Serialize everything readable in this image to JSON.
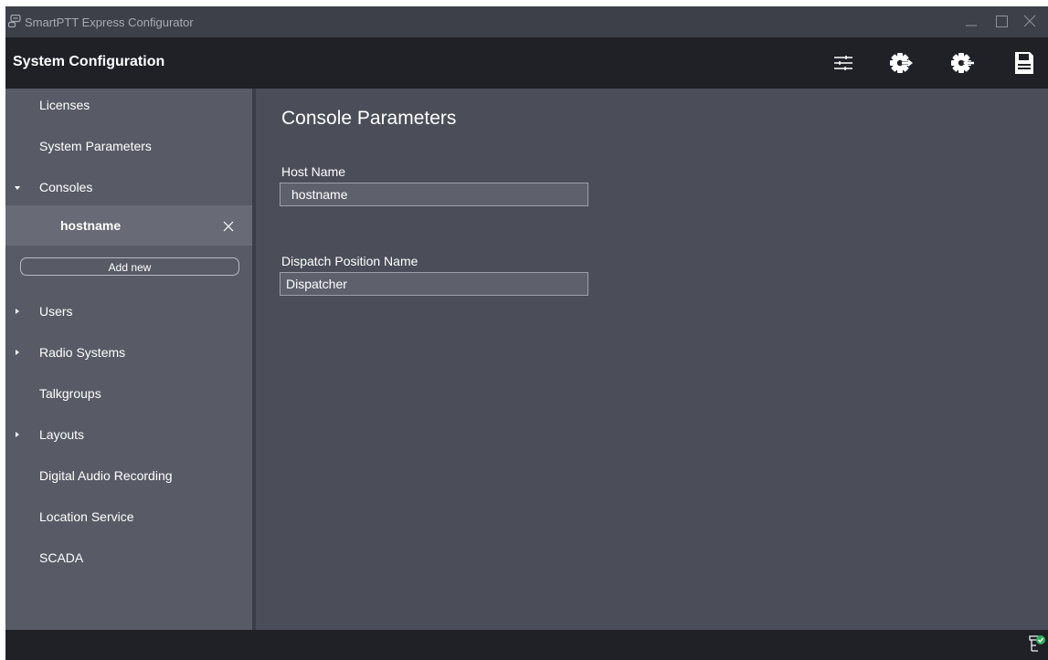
{
  "window": {
    "app_title": "SmartPTT Express Configurator"
  },
  "header": {
    "title": "System Configuration",
    "icons": [
      "filters-icon",
      "export-gear-icon",
      "import-gear-icon",
      "save-icon"
    ]
  },
  "sidebar": {
    "items": {
      "licenses": "Licenses",
      "system_parameters": "System Parameters",
      "consoles": "Consoles",
      "users": "Users",
      "radio_systems": "Radio Systems",
      "talkgroups": "Talkgroups",
      "layouts": "Layouts",
      "digital_audio_recording": "Digital Audio Recording",
      "location_service": "Location Service",
      "scada": "SCADA"
    },
    "console_entry": "hostname",
    "add_new": "Add new"
  },
  "main": {
    "title": "Console Parameters",
    "host_name_label": "Host Name",
    "host_name_value": "hostname",
    "dispatch_label": "Dispatch Position Name",
    "dispatch_value": "Dispatcher"
  },
  "colors": {
    "window_bg": "#4b4e59",
    "sidebar_bg": "#585b66",
    "header_bg": "#1f2127",
    "status_ok": "#2fb35a"
  }
}
